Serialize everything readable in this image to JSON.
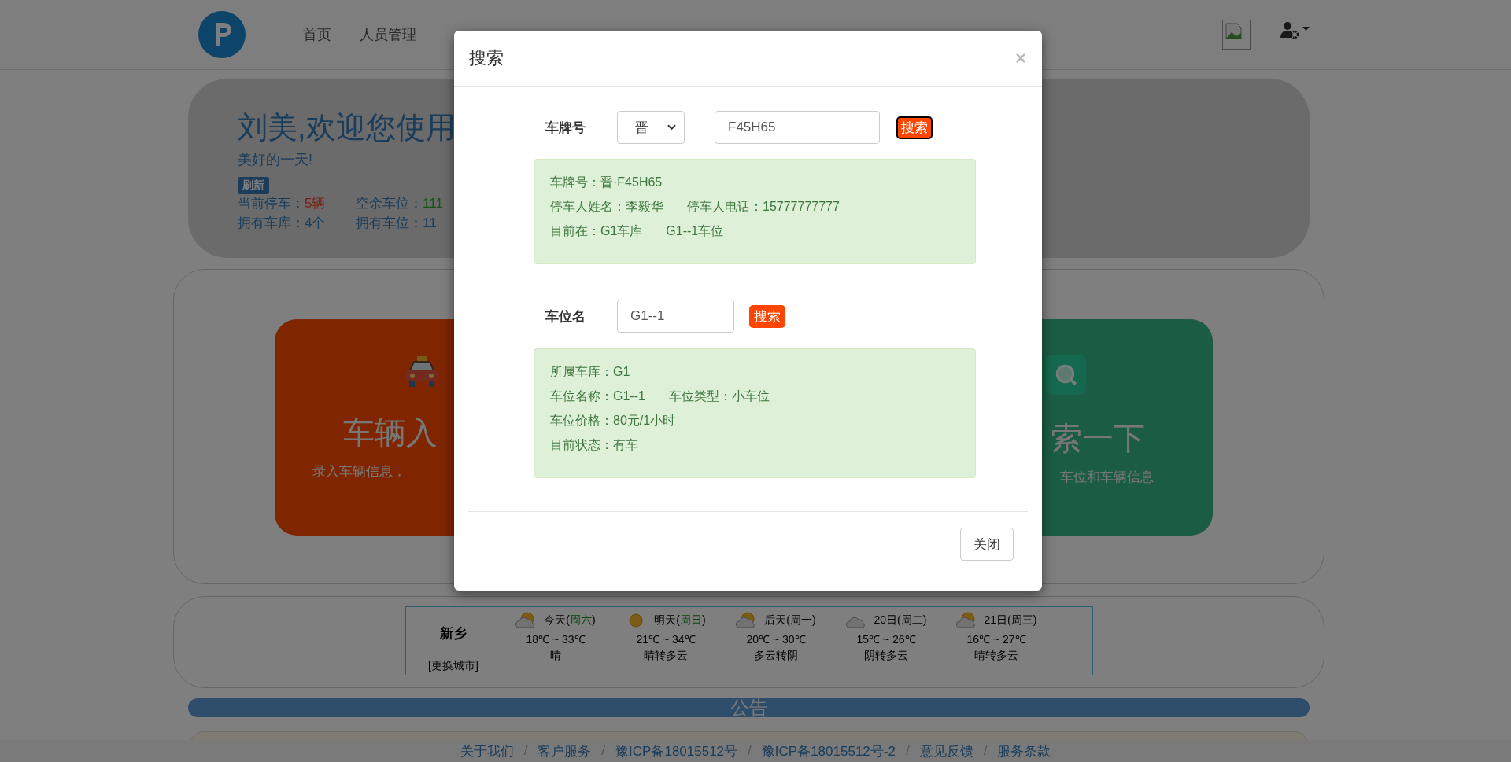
{
  "navbar": {
    "items": [
      "首页",
      "人员管理"
    ]
  },
  "welcome": {
    "title": "刘美,欢迎您使用",
    "subtitle": "美好的一天!",
    "refresh_label": "刷新",
    "stats": [
      {
        "kind": "occupied",
        "label": "当前停车：",
        "value": "5辆"
      },
      {
        "kind": "free",
        "label": "空余车位：",
        "value": "111"
      },
      {
        "kind": "total",
        "label": "拥有车库：",
        "value": "4个"
      },
      {
        "kind": "total",
        "label": "拥有车位：",
        "value": "11"
      }
    ]
  },
  "feature_cards": [
    {
      "kind": "taxi",
      "title": "车辆入",
      "description": "录入车辆信息，"
    },
    {
      "kind": "search",
      "title": "索一下",
      "description": "车位和车辆信息"
    }
  ],
  "weather": {
    "city": "新乡",
    "change_city": "[更换城市]",
    "days": [
      {
        "kind": "sun-cloud",
        "day": "今天(",
        "weekday": "周六",
        "tail": ")",
        "highlight": true,
        "temperature": "18℃ ~ 33℃",
        "condition": "晴"
      },
      {
        "kind": "sun",
        "day": "明天(",
        "weekday": "周日",
        "tail": ")",
        "highlight": true,
        "temperature": "21℃ ~ 34℃",
        "condition": "晴转多云"
      },
      {
        "kind": "sun-cloud",
        "day": "后天(",
        "weekday": "周一",
        "tail": ")",
        "highlight": false,
        "temperature": "20℃ ~ 30℃",
        "condition": "多云转阴"
      },
      {
        "kind": "cloud",
        "day": "20日(",
        "weekday": "周二",
        "tail": ")",
        "highlight": false,
        "temperature": "15℃ ~ 26℃",
        "condition": "阴转多云"
      },
      {
        "kind": "sun-cloud",
        "day": "21日(",
        "weekday": "周三",
        "tail": ")",
        "highlight": false,
        "temperature": "16℃ ~ 27℃",
        "condition": "晴转多云"
      }
    ]
  },
  "notice": {
    "title": "公告"
  },
  "footer": {
    "separator": "/",
    "links": [
      "关于我们",
      "客户服务",
      "豫ICP备18015512号",
      "豫ICP备18015512号-2",
      "意见反馈",
      "服务条款"
    ]
  },
  "modal": {
    "title": "搜索",
    "close_symbol": "×",
    "plate_search": {
      "label": "车牌号",
      "province": "晋",
      "value": "F45H65",
      "button": "搜索",
      "button_focused": true,
      "result": [
        "车牌号：晋·F45H65",
        [
          "停车人姓名：李毅华",
          "停车人电话：15777777777"
        ],
        [
          "目前在：G1车库",
          "G1--1车位"
        ]
      ]
    },
    "space_search": {
      "label": "车位名",
      "value": "G1--1",
      "button": "搜索",
      "button_focused": false,
      "result": [
        "所属车库：G1",
        [
          "车位名称：G1--1",
          "车位类型：小车位"
        ],
        "车位价格：80元/1小时",
        "目前状态：有车"
      ]
    },
    "close_button": "关闭"
  }
}
